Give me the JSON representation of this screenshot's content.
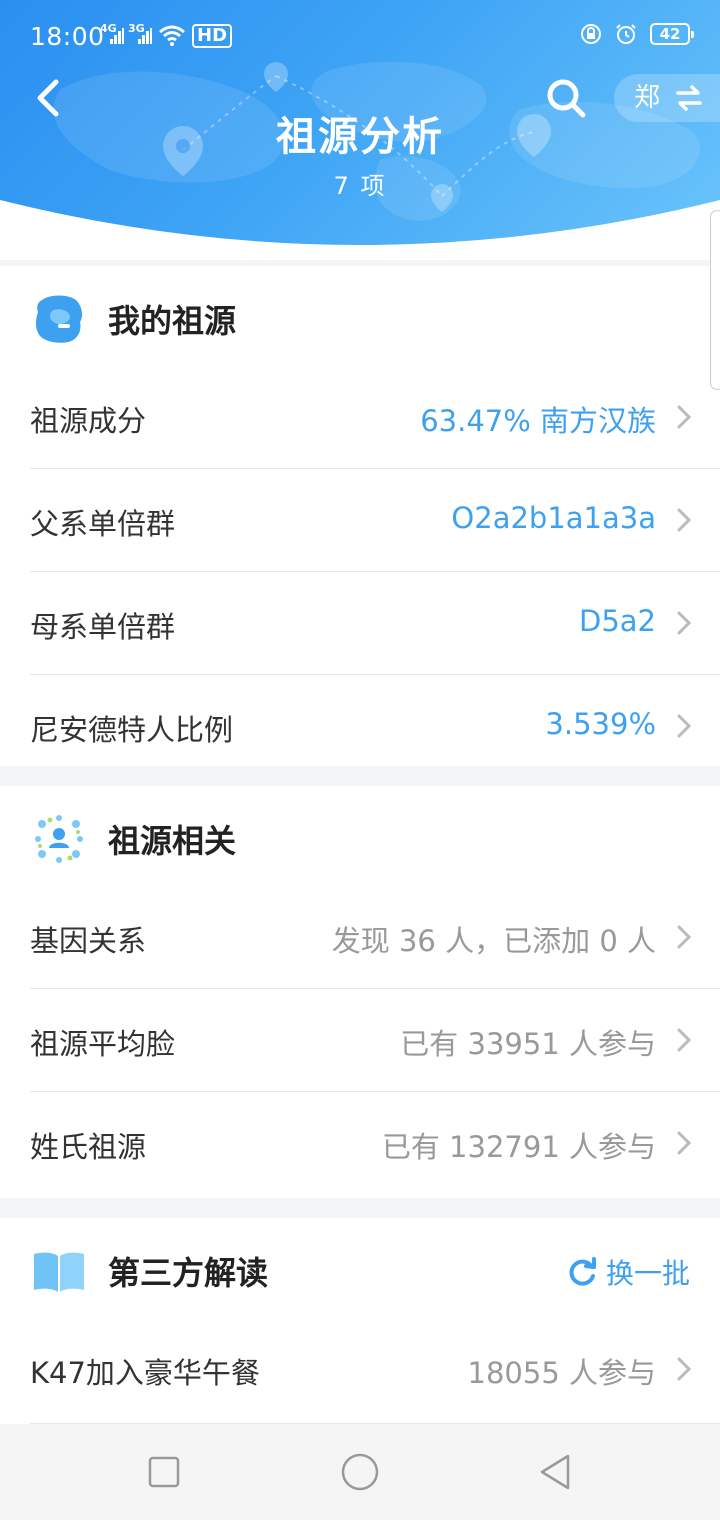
{
  "status_bar": {
    "time": "18:00",
    "signal1": "4G",
    "signal2": "3G",
    "hd": "HD",
    "battery": "42"
  },
  "header": {
    "title": "祖源分析",
    "subtitle": "7 项",
    "surname": "郑"
  },
  "sections": [
    {
      "title": "我的祖源",
      "icon": "ancestry-map-icon",
      "rows": [
        {
          "label": "祖源成分",
          "value": "63.47% 南方汉族",
          "tone": "blue"
        },
        {
          "label": "父系单倍群",
          "value": "O2a2b1a1a3a",
          "tone": "blue"
        },
        {
          "label": "母系单倍群",
          "value": "D5a2",
          "tone": "blue"
        },
        {
          "label": "尼安德特人比例",
          "value": "3.539%",
          "tone": "blue"
        }
      ]
    },
    {
      "title": "祖源相关",
      "icon": "network-people-icon",
      "rows": [
        {
          "label": "基因关系",
          "value": "发现 36 人，已添加 0 人",
          "tone": "gray"
        },
        {
          "label": "祖源平均脸",
          "value": "已有 33951 人参与",
          "tone": "gray"
        },
        {
          "label": "姓氏祖源",
          "value": "已有 132791 人参与",
          "tone": "gray"
        }
      ]
    },
    {
      "title": "第三方解读",
      "icon": "book-icon",
      "refresh_label": "换一批",
      "rows": [
        {
          "label": "K47加入豪华午餐",
          "value": "18055 人参与",
          "tone": "gray"
        }
      ]
    }
  ],
  "colors": {
    "accent": "#3ea1f0",
    "header_start": "#2a8ff0",
    "header_end": "#6cc5fb",
    "value_gray": "#999999"
  }
}
